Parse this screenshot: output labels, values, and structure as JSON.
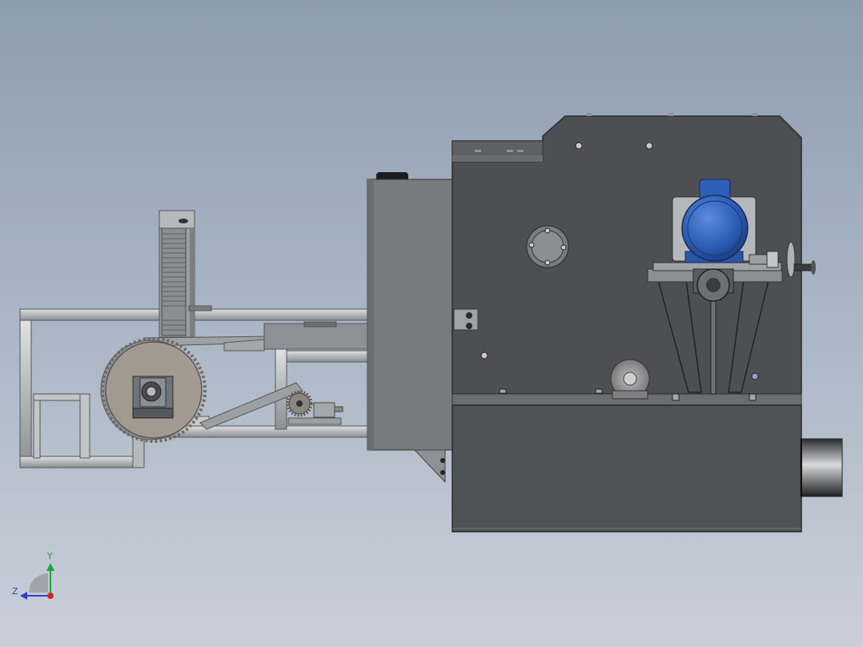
{
  "triad": {
    "y_label": "Y",
    "z_label": "Z",
    "y_color": "#21a336",
    "z_color": "#2f3fc4",
    "x_color": "#d0242a"
  },
  "colors": {
    "background_top": "#8e9cb0",
    "background_bottom": "#c9cfd8",
    "frame": "#b9bcbf",
    "housing": "#4d4f52",
    "motor": "#2d5fb8",
    "gear": "#a29a90"
  }
}
